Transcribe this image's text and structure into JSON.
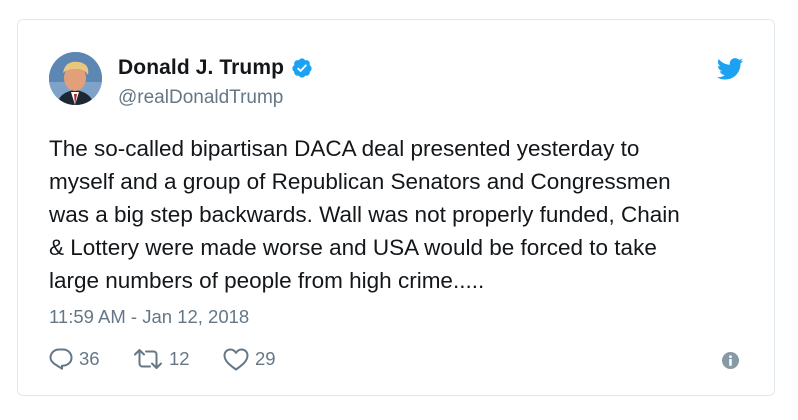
{
  "author": {
    "display_name": "Donald J. Trump",
    "handle": "@realDonaldTrump",
    "verified": true
  },
  "tweet": {
    "text_lines": [
      "The so-called bipartisan DACA deal presented yesterday to",
      "myself and a group of Republican Senators and Congressmen",
      "was a big step backwards. Wall was not properly funded, Chain",
      "& Lottery were made worse and USA would be forced to take",
      "large numbers of people from high crime....."
    ],
    "timestamp": "11:59 AM - Jan 12, 2018"
  },
  "actions": {
    "replies": "36",
    "retweets": "12",
    "likes": "29"
  },
  "icons": {
    "brand": "twitter-bird-icon",
    "verified": "verified-badge-icon",
    "reply": "reply-icon",
    "retweet": "retweet-icon",
    "like": "heart-icon",
    "info": "info-icon"
  },
  "colors": {
    "brand_blue": "#1da1f2",
    "text": "#14171a",
    "muted": "#657786",
    "border": "#e1e8ed"
  }
}
